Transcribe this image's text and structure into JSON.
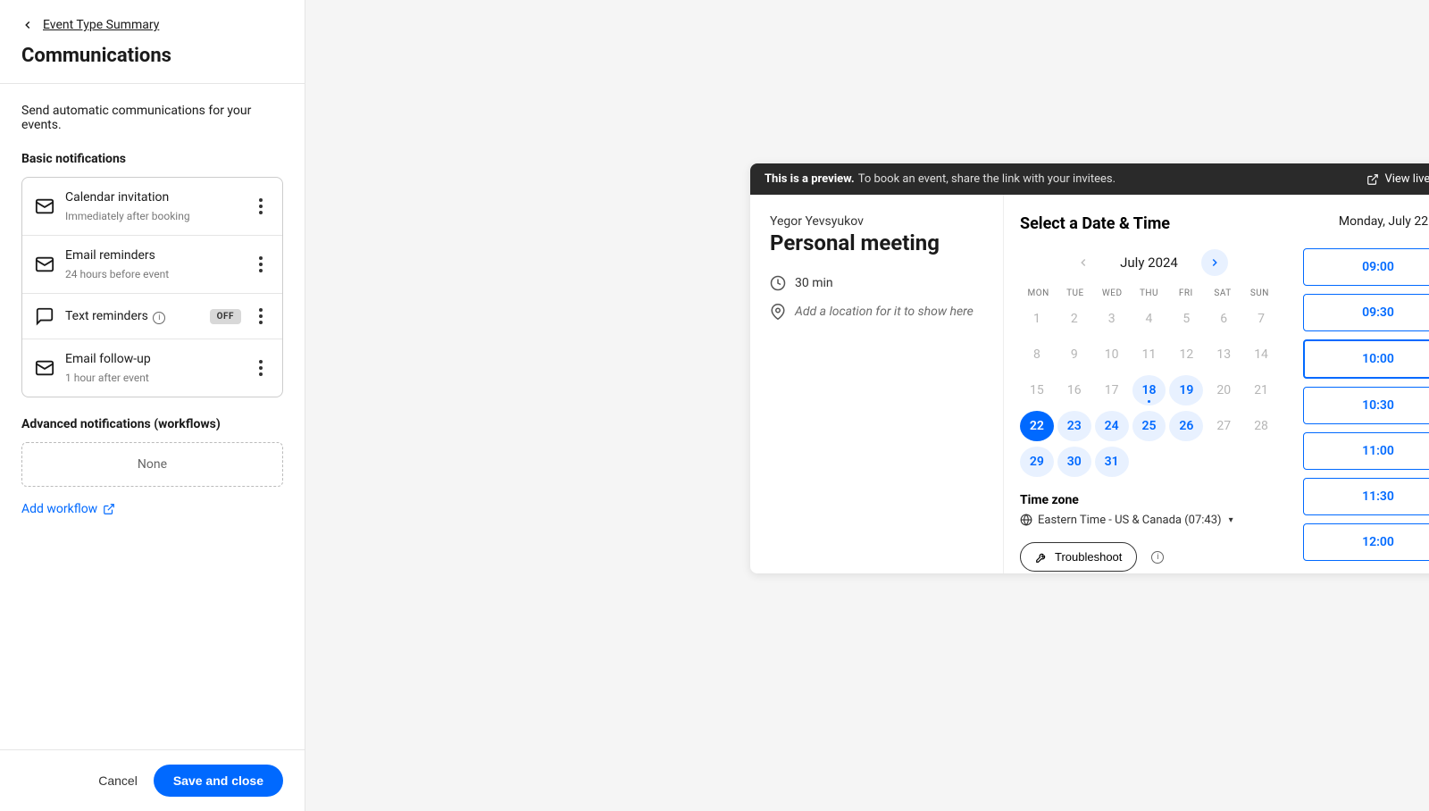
{
  "sidebar": {
    "back": "Event Type Summary",
    "title": "Communications",
    "intro": "Send automatic communications for your events.",
    "basic_h": "Basic notifications",
    "notifs": [
      {
        "title": "Calendar invitation",
        "sub": "Immediately after booking",
        "icon": "mail",
        "off": false,
        "info": false
      },
      {
        "title": "Email reminders",
        "sub": "24 hours before event",
        "icon": "mail",
        "off": false,
        "info": false
      },
      {
        "title": "Text reminders",
        "sub": "",
        "icon": "chat",
        "off": true,
        "info": true
      },
      {
        "title": "Email follow-up",
        "sub": "1 hour after event",
        "icon": "mail",
        "off": false,
        "info": false
      }
    ],
    "off_label": "OFF",
    "adv_h": "Advanced notifications (workflows)",
    "adv_none": "None",
    "add_workflow": "Add workflow",
    "cancel": "Cancel",
    "save": "Save and close"
  },
  "preview": {
    "bar_bold": "This is a preview.",
    "bar_text": "To book an event, share the link with your invitees.",
    "view_live": "View live page",
    "host": "Yegor Yevsyukov",
    "event_title": "Personal meeting",
    "duration": "30 min",
    "location_placeholder": "Add a location for it to show here",
    "select_h": "Select a Date & Time",
    "month": "July 2024",
    "dow": [
      "MON",
      "TUE",
      "WED",
      "THU",
      "FRI",
      "SAT",
      "SUN"
    ],
    "days": [
      {
        "n": 1,
        "state": "off"
      },
      {
        "n": 2,
        "state": "off"
      },
      {
        "n": 3,
        "state": "off"
      },
      {
        "n": 4,
        "state": "off"
      },
      {
        "n": 5,
        "state": "off"
      },
      {
        "n": 6,
        "state": "off"
      },
      {
        "n": 7,
        "state": "off"
      },
      {
        "n": 8,
        "state": "off"
      },
      {
        "n": 9,
        "state": "off"
      },
      {
        "n": 10,
        "state": "off"
      },
      {
        "n": 11,
        "state": "off"
      },
      {
        "n": 12,
        "state": "off"
      },
      {
        "n": 13,
        "state": "off"
      },
      {
        "n": 14,
        "state": "off"
      },
      {
        "n": 15,
        "state": "off"
      },
      {
        "n": 16,
        "state": "off"
      },
      {
        "n": 17,
        "state": "off"
      },
      {
        "n": 18,
        "state": "avail",
        "dot": true
      },
      {
        "n": 19,
        "state": "avail"
      },
      {
        "n": 20,
        "state": "off"
      },
      {
        "n": 21,
        "state": "off"
      },
      {
        "n": 22,
        "state": "sel"
      },
      {
        "n": 23,
        "state": "avail"
      },
      {
        "n": 24,
        "state": "avail"
      },
      {
        "n": 25,
        "state": "avail"
      },
      {
        "n": 26,
        "state": "avail"
      },
      {
        "n": 27,
        "state": "off"
      },
      {
        "n": 28,
        "state": "off"
      },
      {
        "n": 29,
        "state": "avail"
      },
      {
        "n": 30,
        "state": "avail"
      },
      {
        "n": 31,
        "state": "avail"
      },
      {
        "n": 0,
        "state": "empty"
      },
      {
        "n": 0,
        "state": "empty"
      },
      {
        "n": 0,
        "state": "empty"
      },
      {
        "n": 0,
        "state": "empty"
      }
    ],
    "tz_h": "Time zone",
    "tz": "Eastern Time - US & Canada (07:43)",
    "troubleshoot": "Troubleshoot",
    "selected_date": "Monday, July 22",
    "slots": [
      {
        "t": "09:00",
        "sel": false
      },
      {
        "t": "09:30",
        "sel": false
      },
      {
        "t": "10:00",
        "sel": true
      },
      {
        "t": "10:30",
        "sel": false
      },
      {
        "t": "11:00",
        "sel": false
      },
      {
        "t": "11:30",
        "sel": false
      },
      {
        "t": "12:00",
        "sel": false
      }
    ]
  }
}
